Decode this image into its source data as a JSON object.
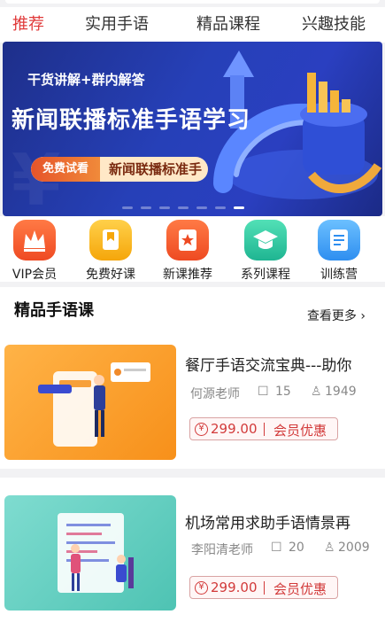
{
  "tabs": [
    {
      "label": "推荐",
      "active": true
    },
    {
      "label": "实用手语",
      "active": false
    },
    {
      "label": "精品课程",
      "active": false
    },
    {
      "label": "兴趣技能",
      "active": false
    }
  ],
  "banner": {
    "subtitle": "干货讲解+群内解答",
    "title": "新闻联播标准手语学习",
    "badge": "免费试看",
    "badge_text": "新闻联播标准手语",
    "slide_count": 7,
    "active_slide": 7
  },
  "shortcuts": [
    {
      "label": "VIP会员",
      "icon": "crown-icon",
      "color": "#f2592c"
    },
    {
      "label": "免费好课",
      "icon": "bookmark-icon",
      "color": "#f7b314"
    },
    {
      "label": "新课推荐",
      "icon": "star-badge-icon",
      "color": "#f05a2a"
    },
    {
      "label": "系列课程",
      "icon": "graduation-cap-icon",
      "color": "#2bc6a0"
    },
    {
      "label": "训练营",
      "icon": "document-icon",
      "color": "#3a9df5"
    }
  ],
  "section": {
    "title": "精品手语课",
    "more": "查看更多"
  },
  "courses": [
    {
      "title": "餐厅手语交流宝典---助你",
      "teacher": "何源老师",
      "lessons": "15",
      "students": "1949",
      "price": "299.00",
      "vip": "会员优惠",
      "thumb_color": "#f79a1e"
    },
    {
      "title": "机场常用求助手语情景再",
      "teacher": "李阳清老师",
      "lessons": "20",
      "students": "2009",
      "price": "299.00",
      "vip": "会员优惠",
      "thumb_color": "#5ccfc0"
    }
  ],
  "currency_symbol": "¥"
}
